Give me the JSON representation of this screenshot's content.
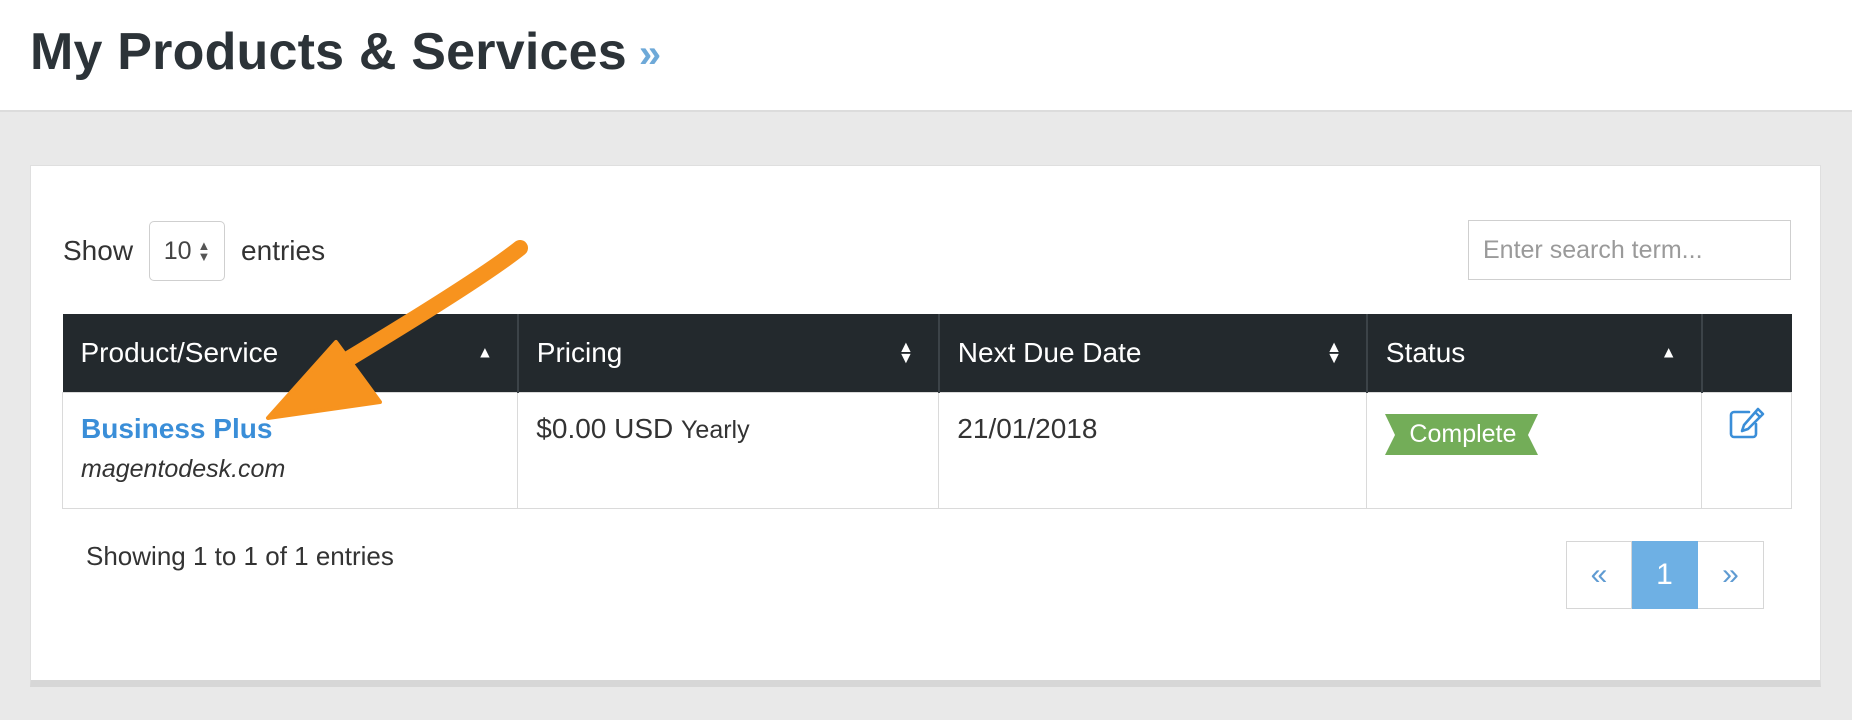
{
  "header": {
    "title": "My Products & Services",
    "title_chevron": "»"
  },
  "controls": {
    "show_label": "Show",
    "page_length": "10",
    "entries_label": "entries",
    "search_placeholder": "Enter search term..."
  },
  "table": {
    "columns": [
      {
        "label": "Product/Service",
        "sort": "asc"
      },
      {
        "label": "Pricing",
        "sort": "both"
      },
      {
        "label": "Next Due Date",
        "sort": "both"
      },
      {
        "label": "Status",
        "sort": "asc"
      },
      {
        "label": "",
        "sort": "none"
      }
    ],
    "rows": [
      {
        "product": "Business Plus",
        "domain": "magentodesk.com",
        "price": "$0.00 USD",
        "cycle": "Yearly",
        "next_due": "21/01/2018",
        "status": "Complete"
      }
    ]
  },
  "footer": {
    "info": "Showing 1 to 1 of 1 entries",
    "pagination": {
      "prev": "«",
      "current": "1",
      "next": "»"
    }
  },
  "colors": {
    "header_bg": "#23292d",
    "link": "#3a8ed8",
    "status_complete": "#73ad58",
    "annotation_arrow": "#f7931e",
    "pagination_active": "#6eb0e4"
  },
  "icons": [
    "sort-asc-icon",
    "sort-both-icon",
    "edit-icon",
    "select-arrows-icon",
    "annotation-arrow"
  ]
}
